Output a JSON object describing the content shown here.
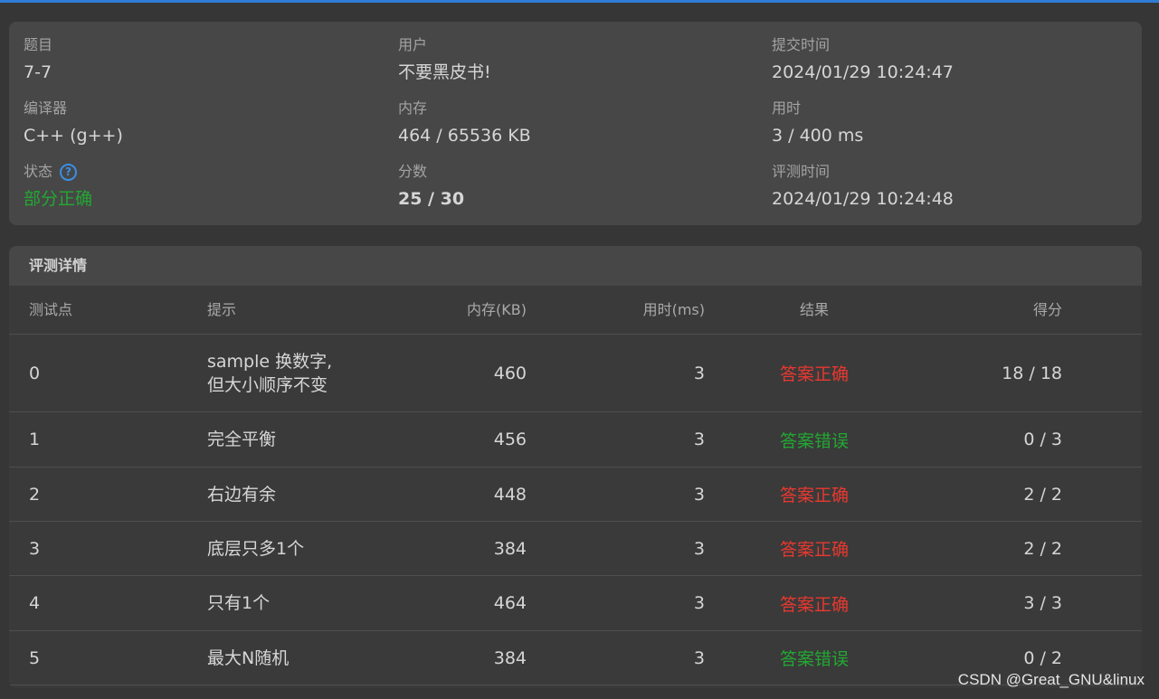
{
  "summary": {
    "problem": {
      "label": "题目",
      "value": "7-7"
    },
    "user": {
      "label": "用户",
      "value": "不要黑皮书!"
    },
    "submit_time": {
      "label": "提交时间",
      "value": "2024/01/29 10:24:47"
    },
    "compiler": {
      "label": "编译器",
      "value": "C++ (g++)"
    },
    "memory": {
      "label": "内存",
      "value": "464 / 65536 KB"
    },
    "time_used": {
      "label": "用时",
      "value": "3 / 400 ms"
    },
    "status": {
      "label": "状态",
      "value": "部分正确",
      "help_icon": "question-circle-icon"
    },
    "score": {
      "label": "分数",
      "value": "25 / 30"
    },
    "judge_time": {
      "label": "评测时间",
      "value": "2024/01/29 10:24:48"
    }
  },
  "details": {
    "title": "评测详情",
    "columns": [
      "测试点",
      "提示",
      "内存(KB)",
      "用时(ms)",
      "结果",
      "得分"
    ],
    "rows": [
      {
        "id": "0",
        "hint": "sample 换数字,\n但大小顺序不变",
        "memory": "460",
        "time": "3",
        "result": "答案正确",
        "score": "18 / 18"
      },
      {
        "id": "1",
        "hint": "完全平衡",
        "memory": "456",
        "time": "3",
        "result": "答案错误",
        "score": "0 / 3"
      },
      {
        "id": "2",
        "hint": "右边有余",
        "memory": "448",
        "time": "3",
        "result": "答案正确",
        "score": "2 / 2"
      },
      {
        "id": "3",
        "hint": "底层只多1个",
        "memory": "384",
        "time": "3",
        "result": "答案正确",
        "score": "2 / 2"
      },
      {
        "id": "4",
        "hint": "只有1个",
        "memory": "464",
        "time": "3",
        "result": "答案正确",
        "score": "3 / 3"
      },
      {
        "id": "5",
        "hint": "最大N随机",
        "memory": "384",
        "time": "3",
        "result": "答案错误",
        "score": "0 / 2"
      }
    ]
  },
  "colors": {
    "accent": "#2e7cd6",
    "correct": "#e8382f",
    "wrong": "#22a832",
    "partial": "#22a832"
  },
  "watermark": "CSDN @Great_GNU&linux"
}
